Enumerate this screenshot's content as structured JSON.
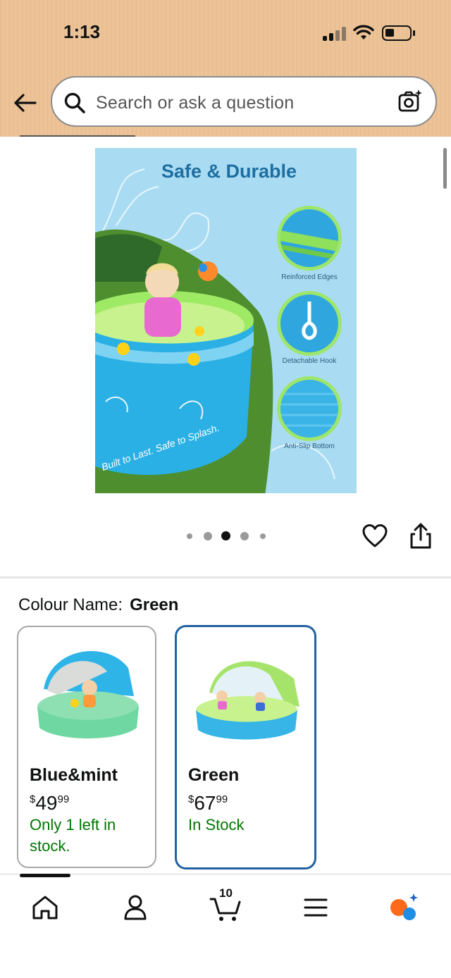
{
  "status_bar": {
    "time": "1:13"
  },
  "search": {
    "placeholder": "Search or ask a question"
  },
  "product_image": {
    "title": "Safe & Durable",
    "features": [
      "Reinforced Edges",
      "Detachable Hook",
      "Anti-Slip Bottom"
    ],
    "tagline": "Built to Last. Safe to Splash.",
    "active_image_index": 3,
    "image_count": 5
  },
  "colour": {
    "label": "Colour Name:",
    "selected": "Green"
  },
  "variants": [
    {
      "name": "Blue&mint",
      "currency": "$",
      "price_whole": "49",
      "price_fraction": "99",
      "stock": "Only 1 left in stock.",
      "selected": false
    },
    {
      "name": "Green",
      "currency": "$",
      "price_whole": "67",
      "price_fraction": "99",
      "stock": "In Stock",
      "selected": true
    }
  ],
  "nav": {
    "items": [
      "home-icon",
      "account-icon",
      "cart-icon",
      "menu-icon",
      "assistant-icon"
    ],
    "cart_count": "10"
  },
  "colors": {
    "header_bg": "#edc49a",
    "selected_border": "#2162a1",
    "stock_green": "#007600",
    "assistant_orange": "#ff6a1a",
    "assistant_blue": "#1f8fe5"
  }
}
